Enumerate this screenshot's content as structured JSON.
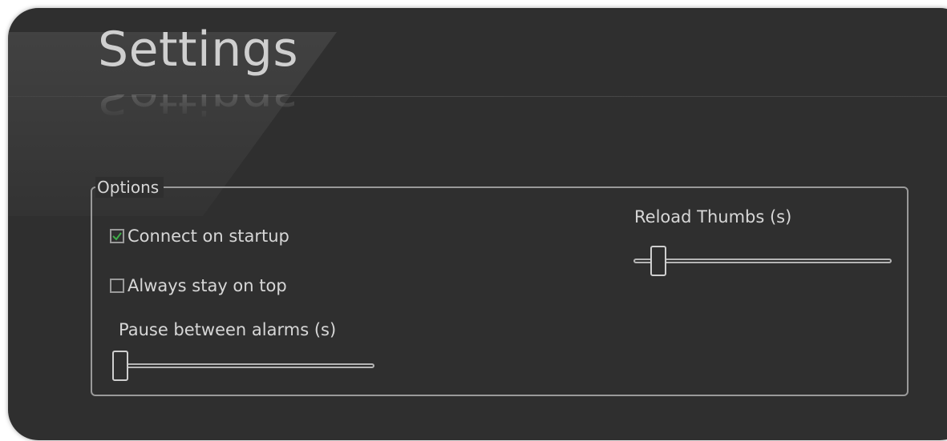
{
  "window": {
    "title": "Settings"
  },
  "options_group": {
    "legend": "Options",
    "checkboxes": [
      {
        "label": "Connect on startup",
        "checked": true
      },
      {
        "label": "Always stay on top",
        "checked": false
      }
    ],
    "sliders": [
      {
        "label": "Pause between alarms (s)",
        "value_fraction": 0.0
      },
      {
        "label": "Reload Thumbs (s)",
        "value_fraction": 0.07
      }
    ]
  },
  "colors": {
    "background": "#2f2f2f",
    "text": "#d7d7d7",
    "border": "#9a9a9a",
    "check": "#3fae49"
  },
  "icons": {
    "checkmark": "checkmark-icon"
  }
}
